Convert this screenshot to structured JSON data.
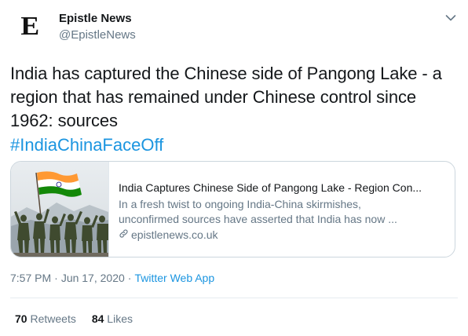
{
  "header": {
    "avatar_letter": "E",
    "display_name": "Epistle News",
    "handle": "@EpistleNews",
    "menu_icon": "chevron-down-icon"
  },
  "tweet": {
    "text": "India has captured the Chinese side of Pangong Lake - a region that has remained under Chinese control since 1962: sources",
    "hashtag": "#IndiaChinaFaceOff"
  },
  "card": {
    "image": "soldiers-with-flag-photo",
    "title": "India Captures Chinese Side of Pangong Lake - Region Con...",
    "description_line1": "In a fresh twist to ongoing India-China skirmishes,",
    "description_line2": "unconfirmed sources have asserted that India has now ...",
    "link_icon": "link-icon",
    "domain": "epistlenews.co.uk"
  },
  "meta": {
    "time": "7:57 PM",
    "sep1": "·",
    "date": "Jun 17, 2020",
    "sep2": "·",
    "source": "Twitter Web App"
  },
  "stats": {
    "retweets_count": "70",
    "retweets_label": "Retweets",
    "likes_count": "84",
    "likes_label": "Likes"
  },
  "colors": {
    "link_blue": "#1b95e0",
    "secondary_text": "#657786",
    "border": "#ccd6dd"
  }
}
